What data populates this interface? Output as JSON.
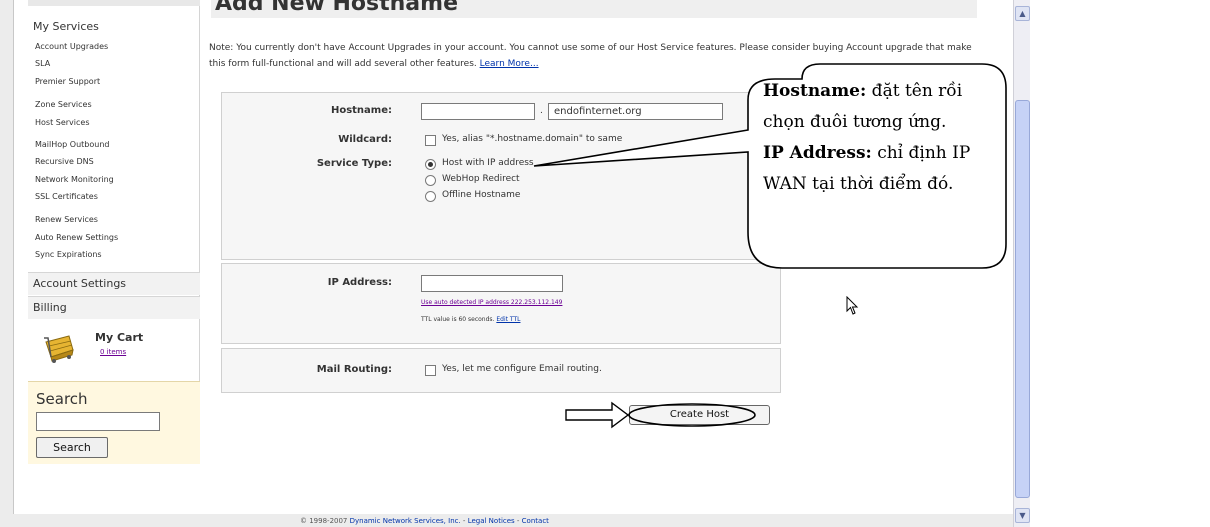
{
  "sidebar": {
    "my_services": "My Services",
    "links": [
      "Account Upgrades",
      "SLA",
      "Premier Support",
      "Zone Services",
      "Host Services",
      "MailHop Outbound",
      "Recursive DNS",
      "Network Monitoring",
      "SSL Certificates",
      "Renew Services",
      "Auto Renew Settings",
      "Sync Expirations"
    ],
    "account_settings": "Account Settings",
    "billing": "Billing",
    "cart_title": "My Cart",
    "cart_items": "0 items",
    "search_title": "Search",
    "search_button": "Search"
  },
  "main": {
    "title": "Add New Hostname",
    "note": "Note: You currently don't have Account Upgrades in your account. You cannot use some of our Host Service features. Please consider buying Account upgrade that make this form full-functional and will add several other features.",
    "learn_more": "Learn More..."
  },
  "form": {
    "hostname_label": "Hostname:",
    "domain_dot": ".",
    "domain_value": "endofinternet.org",
    "wildcard_label": "Wildcard:",
    "wildcard_text": "Yes, alias \"*.hostname.domain\" to same",
    "service_type_label": "Service Type:",
    "service_options": [
      "Host with IP address",
      "WebHop Redirect",
      "Offline Hostname"
    ],
    "ip_label": "IP Address:",
    "ip_auto_link": "Use auto detected IP address 222.253.112.149",
    "ttl_text": "TTL value is 60 seconds.",
    "ttl_edit": "Edit TTL",
    "mail_label": "Mail Routing:",
    "mail_text": "Yes, let me configure Email routing.",
    "create_button": "Create Host"
  },
  "callout": {
    "hostname_bold": "Hostname:",
    "hostname_text": " đặt tên rồi chọn đuôi tương ứng.",
    "ip_bold": "IP Address:",
    "ip_text": " chỉ định IP WAN tại thời điểm đó."
  },
  "footer": {
    "copyright": "© 1998-2007 ",
    "company": "Dynamic Network Services, Inc.",
    "sep1": " - ",
    "legal": "Legal Notices",
    "sep2": " - ",
    "contact": "Contact"
  }
}
